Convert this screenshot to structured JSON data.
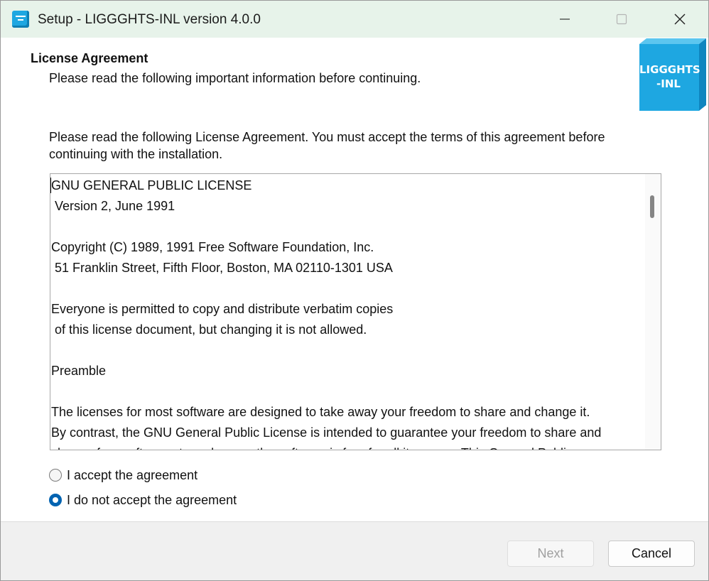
{
  "window": {
    "title": "Setup - LIGGGHTS-INL version 4.0.0"
  },
  "header": {
    "title": "License Agreement",
    "subtitle": "Please read the following important information before continuing.",
    "logo_line1": "LIGGGHTS",
    "logo_line2": "-INL"
  },
  "intro": {
    "line1": "Please read the following License Agreement. You must accept the terms of this agreement before",
    "line2": "continuing with the installation."
  },
  "license": {
    "lines": [
      "GNU GENERAL PUBLIC LICENSE",
      " Version 2, June 1991",
      "",
      "Copyright (C) 1989, 1991 Free Software Foundation, Inc.",
      " 51 Franklin Street, Fifth Floor, Boston, MA 02110-1301 USA",
      "",
      "Everyone is permitted to copy and distribute verbatim copies",
      " of this license document, but changing it is not allowed.",
      "",
      "Preamble",
      "",
      "The licenses for most software are designed to take away your freedom to share and change it.",
      "By contrast, the GNU General Public License is intended to guarantee your freedom to share and",
      "change free software--to make sure the software is free for all its users.  This General Public"
    ]
  },
  "options": {
    "accept_label": "I accept the agreement",
    "decline_label": "I do not accept the agreement",
    "selected": "decline"
  },
  "buttons": {
    "next_label": "Next",
    "cancel_label": "Cancel"
  },
  "colors": {
    "titlebar_bg": "#e7f3ea",
    "accent": "#0063b1",
    "logo_cyan": "#1ea7e1"
  },
  "icons": {
    "app": "app-icon",
    "minimize": "minimize-icon",
    "maximize": "maximize-icon",
    "close": "close-icon"
  }
}
